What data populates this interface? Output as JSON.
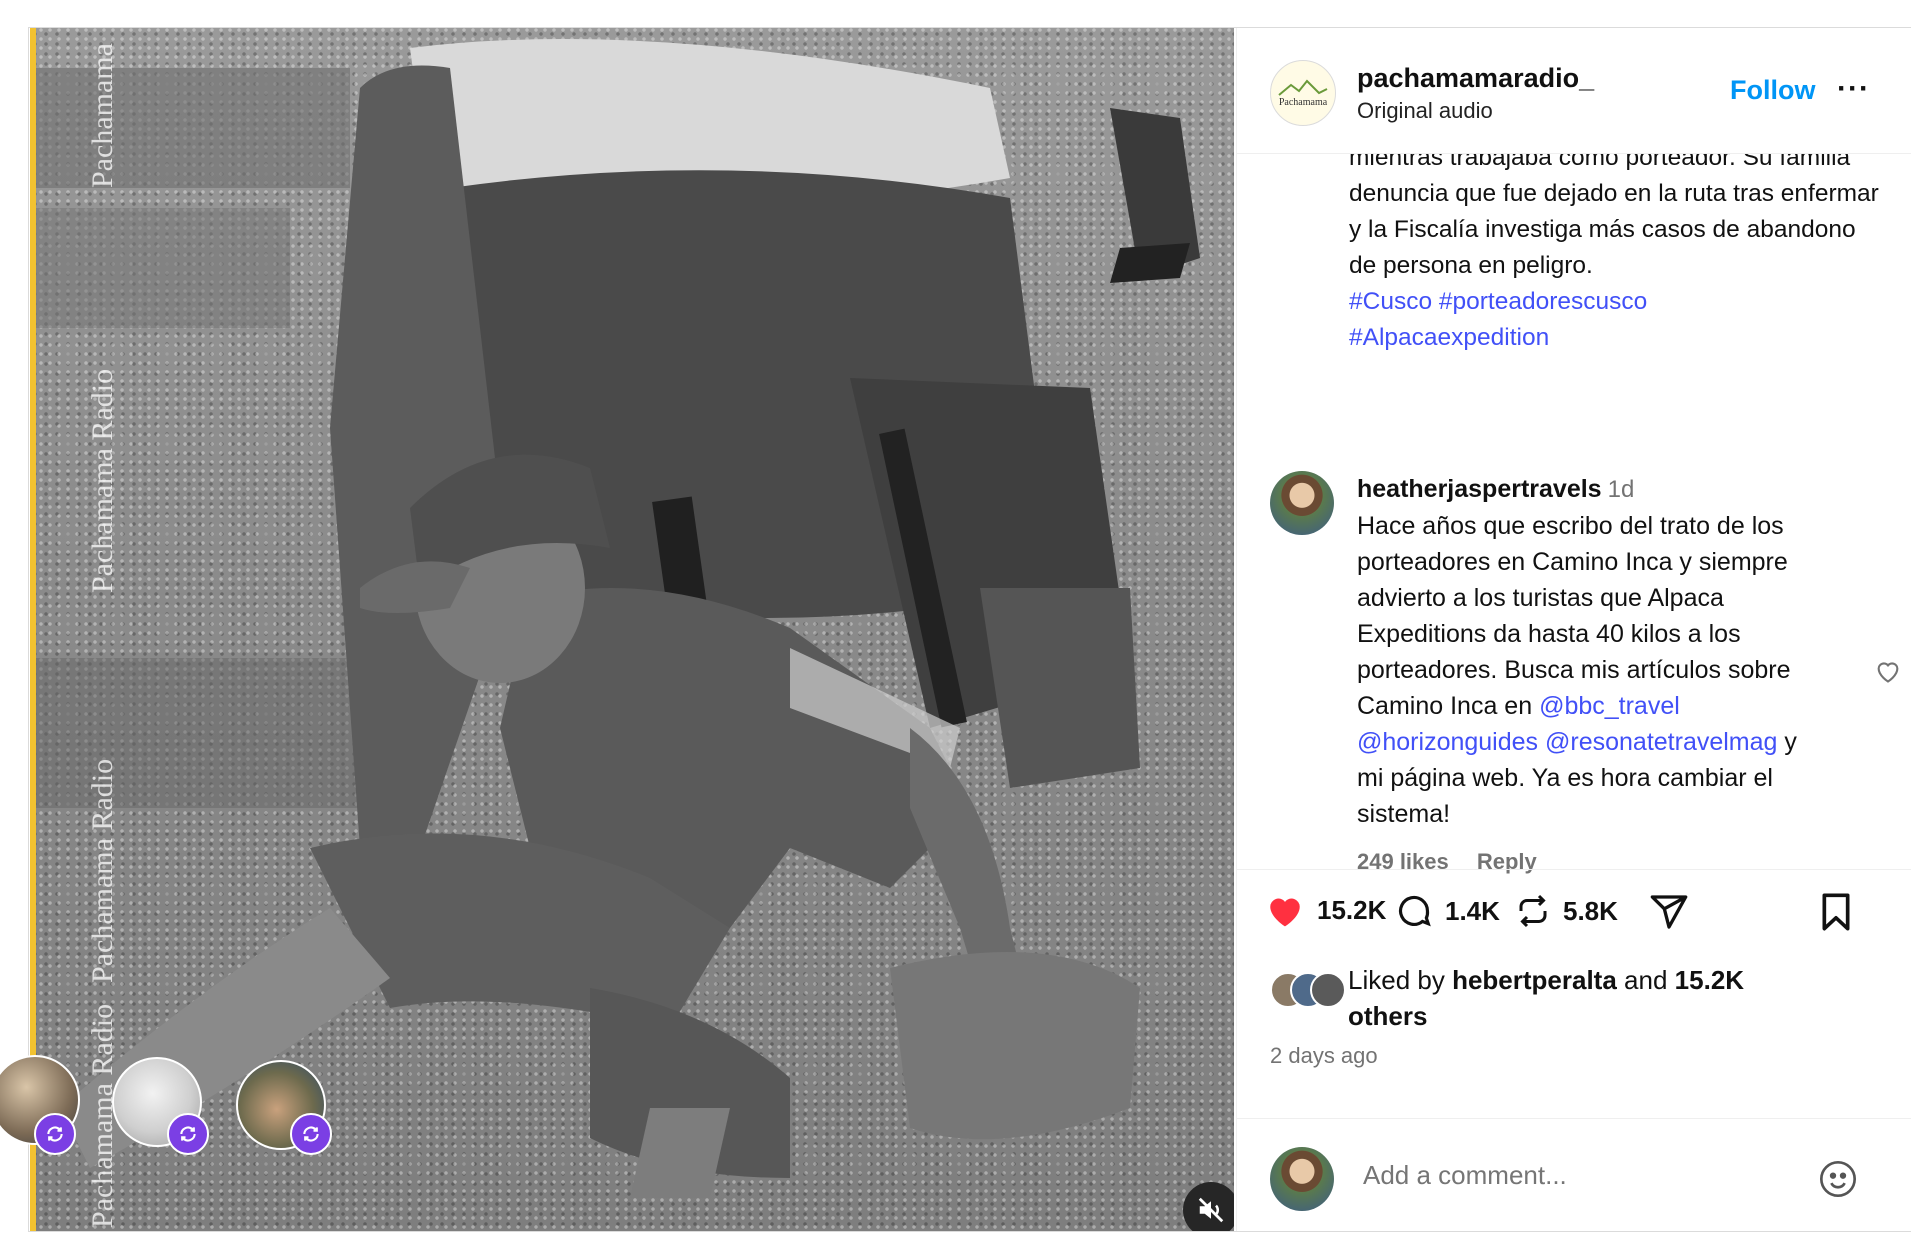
{
  "media": {
    "watermark": "Pachamama Radio",
    "watermark_top": "Pachamama",
    "watermark_bottom": "Pachamama Radio"
  },
  "header": {
    "avatar_text": "Pachamama",
    "username": "pachamamaradio_",
    "subtitle": "Original audio",
    "follow_label": "Follow",
    "more_label": "···"
  },
  "caption": {
    "text": "mientras trabajaba como porteador. Su familia denuncia que fue dejado en la ruta tras enfermar y la Fiscalía investiga más casos de abandono de persona en peligro.",
    "tag1": "#Cusco",
    "tag2": "#porteadorescusco",
    "tag3": "#Alpacaexpedition"
  },
  "comment": {
    "username": "heatherjaspertravels",
    "time": "1d",
    "text_part1": "Hace años que escribo del trato de los porteadores en Camino Inca y siempre advierto a los turistas que Alpaca Expeditions da hasta 40 kilos a los porteadores. Busca mis artículos sobre Camino Inca en",
    "mention1": "@bbc_travel",
    "mention2": "@horizonguides",
    "mention3": "@resonatetravelmag",
    "text_part2": "y mi página web. Ya es hora cambiar el sistema!",
    "likes": "249 likes",
    "reply_label": "Reply"
  },
  "actions": {
    "likes_count": "15.2K",
    "comments_count": "1.4K",
    "reposts_count": "5.8K",
    "liked_by_prefix": "Liked by",
    "liked_by_user": "hebertperalta",
    "liked_by_and": "and",
    "liked_by_count": "15.2K others",
    "time_ago": "2 days ago"
  },
  "add_comment": {
    "placeholder": "Add a comment..."
  },
  "colors": {
    "link_blue": "#4150f7",
    "follow_blue": "#0095f6",
    "heart_red": "#ff3040",
    "repost_purple": "#7b3fe4",
    "accent_yellow": "#f2c230"
  }
}
